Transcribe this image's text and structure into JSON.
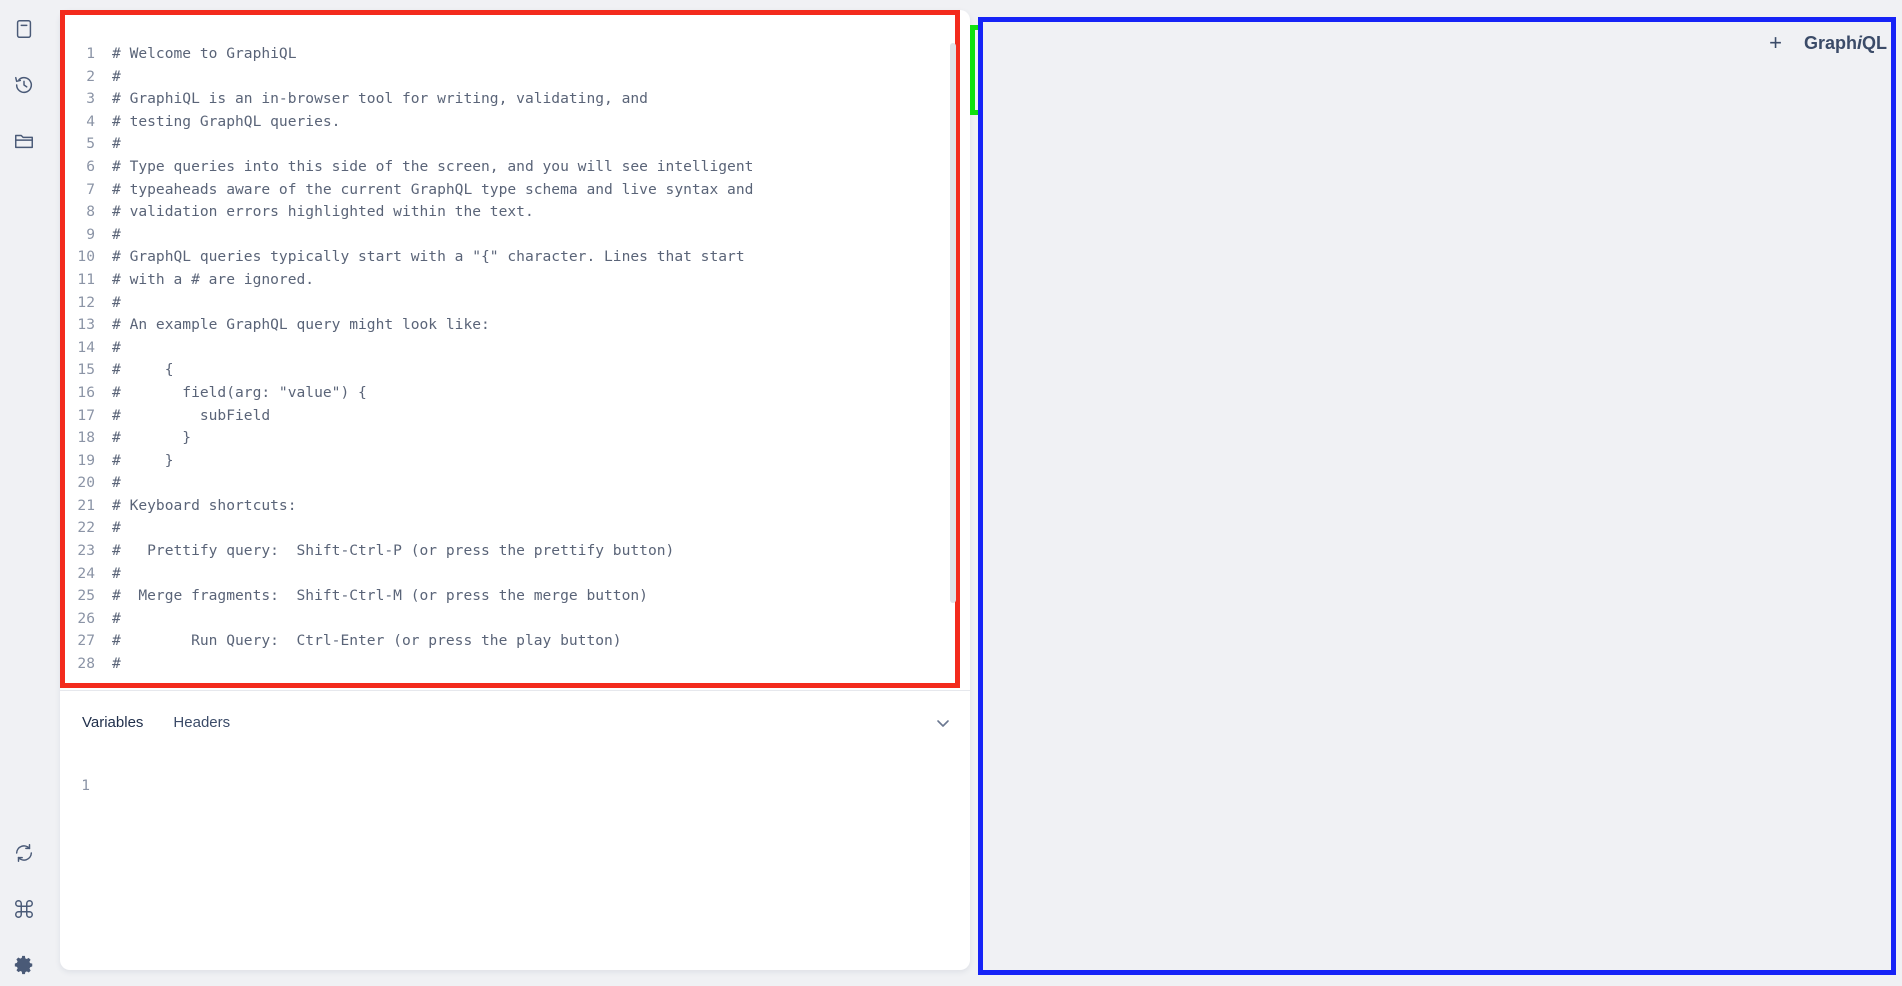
{
  "sidebar": {
    "top_icons": [
      "documentation-icon",
      "history-icon",
      "collections-icon"
    ],
    "bottom_icons": [
      "refetch-schema-icon",
      "keyboard-shortcuts-icon",
      "settings-icon"
    ]
  },
  "editor": {
    "lines": [
      {
        "n": "1",
        "t": "# Welcome to GraphiQL"
      },
      {
        "n": "2",
        "t": "#"
      },
      {
        "n": "3",
        "t": "# GraphiQL is an in-browser tool for writing, validating, and"
      },
      {
        "n": "4",
        "t": "# testing GraphQL queries."
      },
      {
        "n": "5",
        "t": "#"
      },
      {
        "n": "6",
        "t": "# Type queries into this side of the screen, and you will see intelligent"
      },
      {
        "n": "7",
        "t": "# typeaheads aware of the current GraphQL type schema and live syntax and"
      },
      {
        "n": "8",
        "t": "# validation errors highlighted within the text."
      },
      {
        "n": "9",
        "t": "#"
      },
      {
        "n": "10",
        "t": "# GraphQL queries typically start with a \"{\" character. Lines that start"
      },
      {
        "n": "11",
        "t": "# with a # are ignored."
      },
      {
        "n": "12",
        "t": "#"
      },
      {
        "n": "13",
        "t": "# An example GraphQL query might look like:"
      },
      {
        "n": "14",
        "t": "#"
      },
      {
        "n": "15",
        "t": "#     {"
      },
      {
        "n": "16",
        "t": "#       field(arg: \"value\") {"
      },
      {
        "n": "17",
        "t": "#         subField"
      },
      {
        "n": "18",
        "t": "#       }"
      },
      {
        "n": "19",
        "t": "#     }"
      },
      {
        "n": "20",
        "t": "#"
      },
      {
        "n": "21",
        "t": "# Keyboard shortcuts:"
      },
      {
        "n": "22",
        "t": "#"
      },
      {
        "n": "23",
        "t": "#   Prettify query:  Shift-Ctrl-P (or press the prettify button)"
      },
      {
        "n": "24",
        "t": "#"
      },
      {
        "n": "25",
        "t": "#  Merge fragments:  Shift-Ctrl-M (or press the merge button)"
      },
      {
        "n": "26",
        "t": "#"
      },
      {
        "n": "27",
        "t": "#        Run Query:  Ctrl-Enter (or press the play button)"
      },
      {
        "n": "28",
        "t": "#"
      }
    ]
  },
  "toolbar": {
    "run_icon": "play-icon",
    "tools": [
      "prettify-icon",
      "merge-fragments-icon",
      "copy-query-icon"
    ]
  },
  "bottom_panel": {
    "tabs": [
      "Variables",
      "Headers"
    ],
    "active_tab": "Variables",
    "variables_lines": [
      {
        "n": "1",
        "t": ""
      }
    ]
  },
  "response": {
    "add_tab_label": "+",
    "logo_prefix": "Graph",
    "logo_italic": "i",
    "logo_suffix": "QL"
  },
  "colors": {
    "run_button": "#e10098",
    "editor_frame": "#f32b1d",
    "run_frame": "#10e011",
    "response_frame": "#1623f7"
  }
}
